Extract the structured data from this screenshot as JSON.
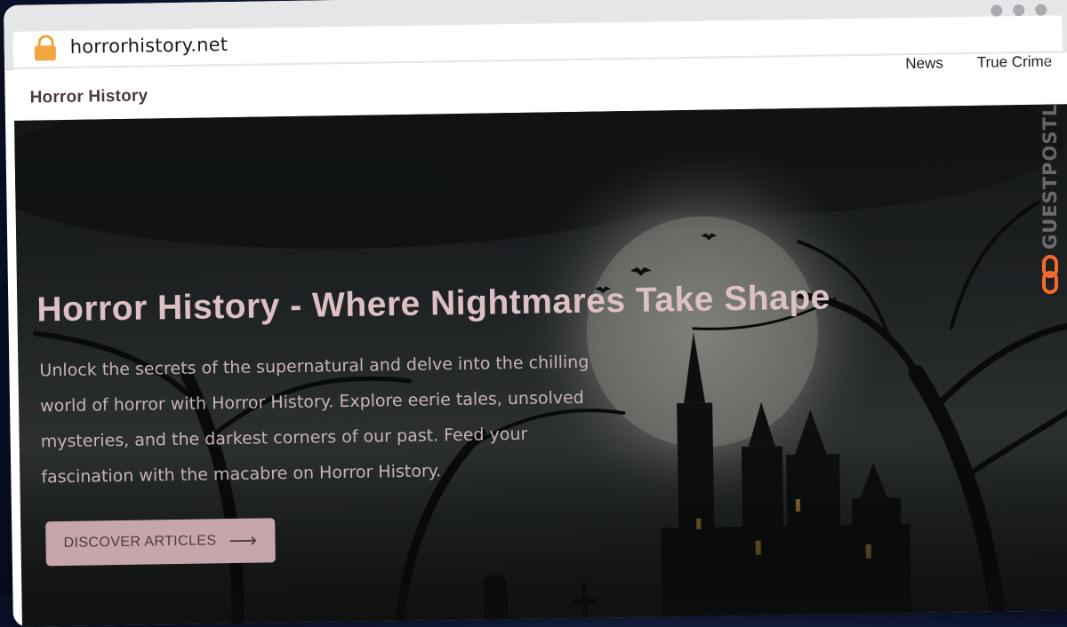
{
  "browser": {
    "url": "horrorhistory.net",
    "lock_icon": "lock-icon",
    "window_controls": [
      "dot",
      "dot",
      "dot"
    ]
  },
  "site": {
    "brand": "Horror History",
    "nav": [
      "News",
      "True Crime"
    ]
  },
  "hero": {
    "title": "Horror History - Where Nightmares Take Shape",
    "description": "Unlock the secrets of the supernatural and delve into the chilling world of horror with Horror History. Explore eerie tales, unsolved mysteries, and the darkest corners of our past. Feed your fascination with the macabre on Horror History.",
    "cta_label": "DISCOVER ARTICLES",
    "cta_icon": "arrow-right-icon"
  },
  "watermark": {
    "text": "GUESTPOSTLINKS",
    "icon": "chain-link-icon"
  },
  "colors": {
    "cta_bg": "#c6a6aa",
    "title_text": "#dcc0c3",
    "accent_orange": "#f26a2e"
  }
}
